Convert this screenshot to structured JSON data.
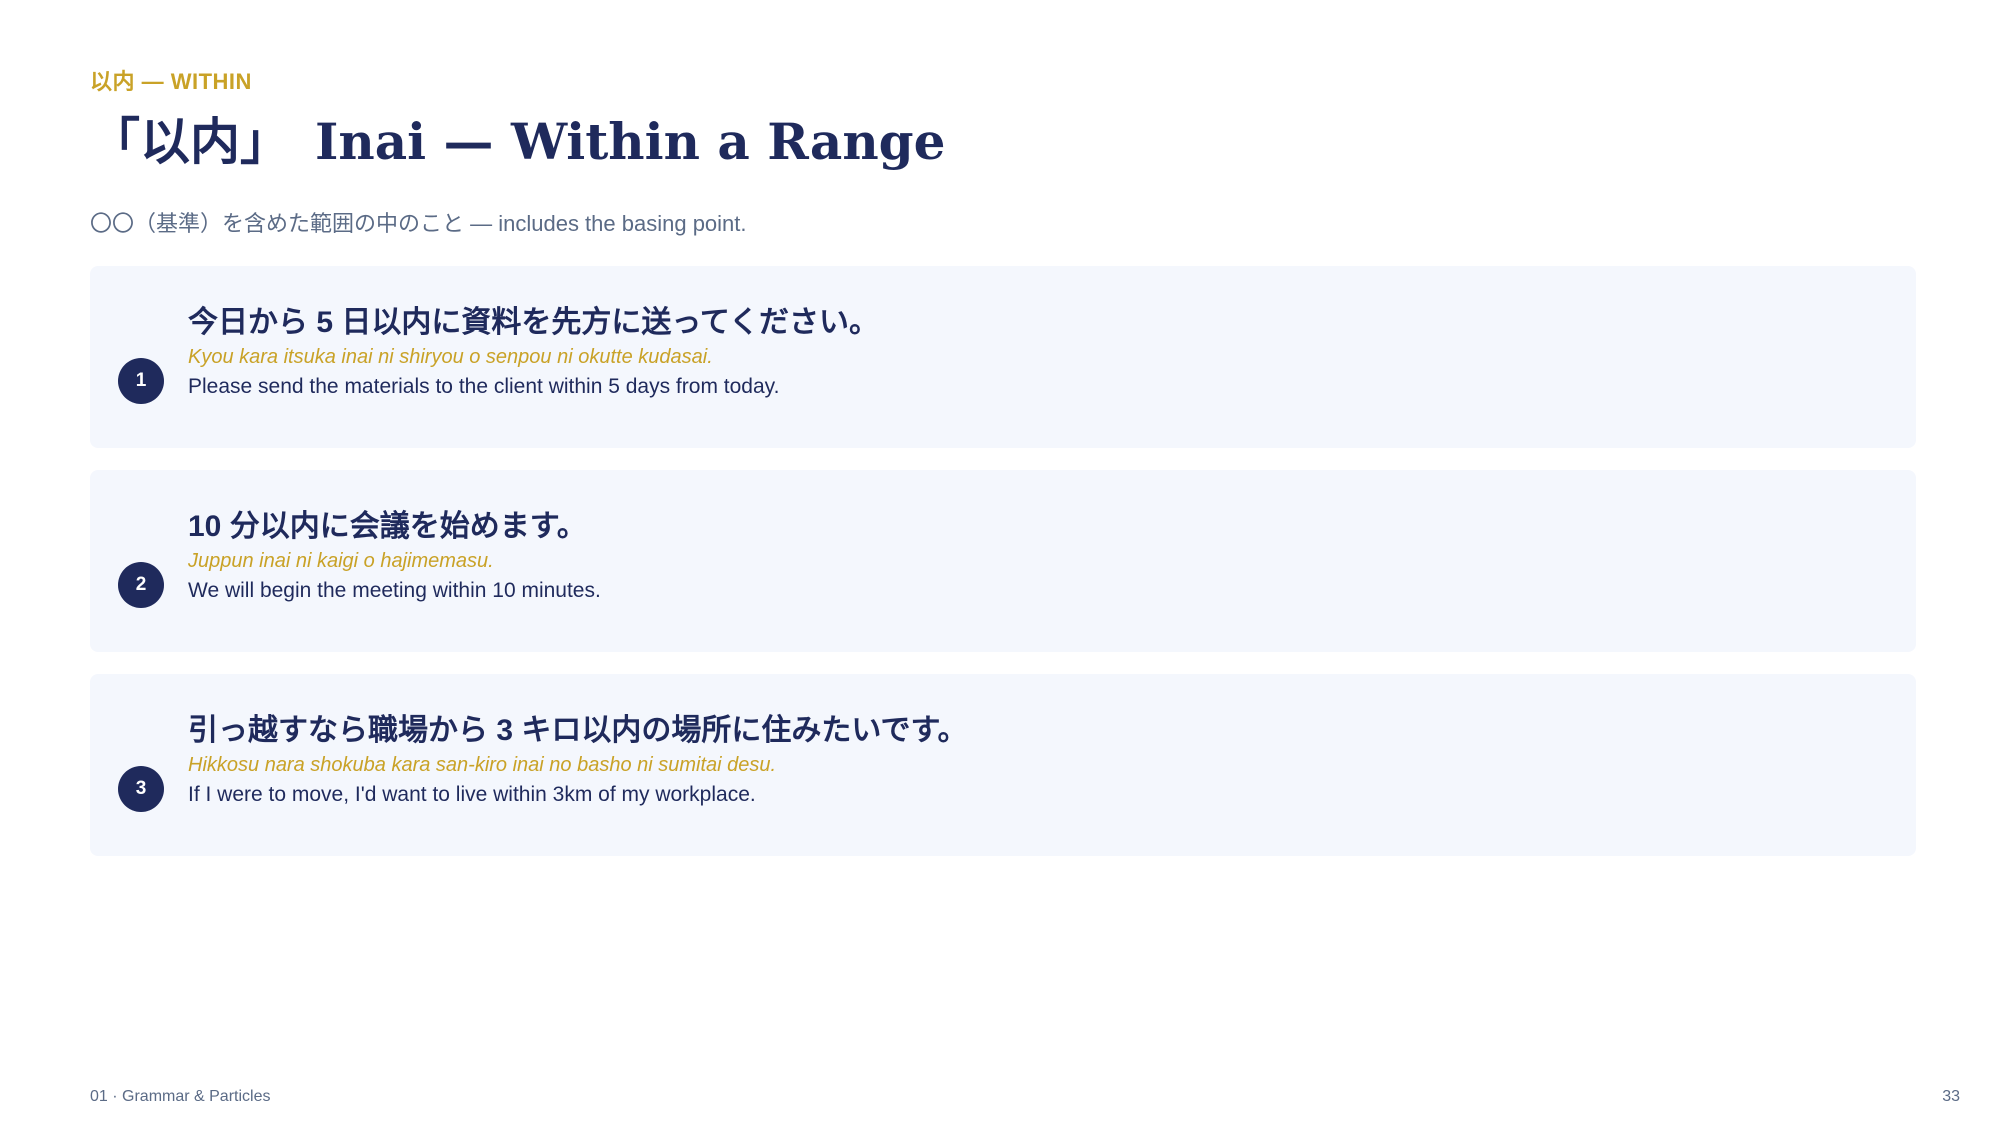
{
  "header": {
    "kicker": "以内 —  WITHIN",
    "title": "「以内」　Inai — Within a Range",
    "subtitle": "〇〇（基準）を含めた範囲の中のこと —  includes the basing point."
  },
  "examples": [
    {
      "number": "1",
      "japanese": "今日から 5 日以内に資料を先方に送ってください。",
      "romaji": "Kyou kara itsuka inai ni shiryou o senpou ni okutte kudasai.",
      "english": "Please send the materials to the client within 5 days from today."
    },
    {
      "number": "2",
      "japanese": "10 分以内に会議を始めます。",
      "romaji": "Juppun inai ni kaigi o hajimemasu.",
      "english": "We will begin the meeting within 10 minutes."
    },
    {
      "number": "3",
      "japanese": "引っ越すなら職場から 3 キロ以内の場所に住みたいです。",
      "romaji": "Hikkosu nara shokuba kara san-kiro inai no basho ni sumitai desu.",
      "english": "If I were to move, I'd want to live within 3km of my workplace."
    }
  ],
  "footer": {
    "section": "01 · Grammar & Particles",
    "page_number": "33"
  },
  "colors": {
    "navy": "#1f2a5c",
    "gold": "#c9a227",
    "card_bg": "#f4f7fd",
    "muted": "#5b6b86"
  }
}
